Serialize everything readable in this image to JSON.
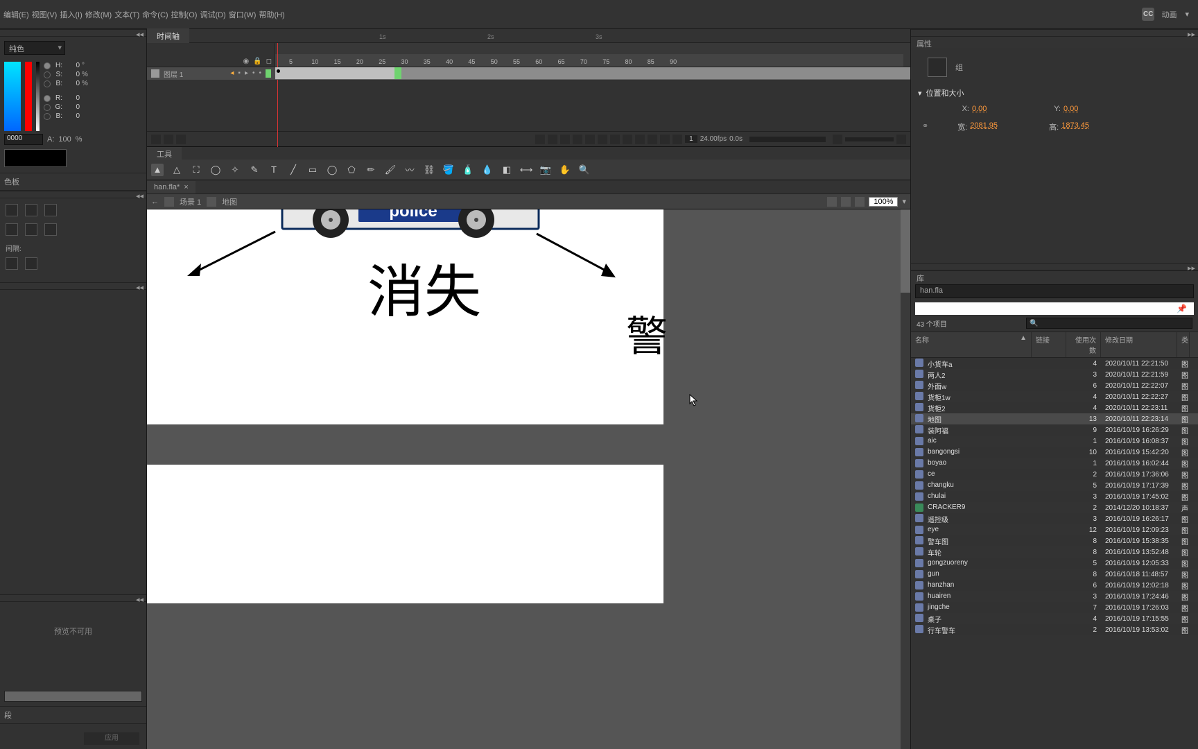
{
  "menu": {
    "items": [
      "编辑(E)",
      "视图(V)",
      "插入(I)",
      "修改(M)",
      "文本(T)",
      "命令(C)",
      "控制(O)",
      "调试(D)",
      "窗口(W)",
      "帮助(H)"
    ],
    "cc": "CC",
    "workspace": "动画",
    "wscarrot": "▾"
  },
  "left": {
    "color_mode": "纯色",
    "hsb": [
      {
        "l": "H:",
        "v": "0",
        "u": "°"
      },
      {
        "l": "S:",
        "v": "0",
        "u": "%"
      },
      {
        "l": "B:",
        "v": "0",
        "u": "%"
      }
    ],
    "rgb": [
      {
        "l": "R:",
        "v": "0"
      },
      {
        "l": "G:",
        "v": "0"
      },
      {
        "l": "B:",
        "v": "0"
      }
    ],
    "alpha_label": "A:",
    "alpha_val": "100",
    "alpha_unit": "%",
    "hex": "0000",
    "swatch_name": "色板",
    "align_label": "间隔:",
    "preview_text": "预览不可用",
    "historyname": "段",
    "apply": "应用"
  },
  "timeline": {
    "tab": "时间轴",
    "layer": "图层 1",
    "ruler_nums": [
      "5",
      "10",
      "15",
      "20",
      "25",
      "30",
      "35",
      "40",
      "45",
      "50",
      "55",
      "60",
      "65",
      "70",
      "75",
      "80",
      "85",
      "90"
    ],
    "sec_marks": [
      "1s",
      "2s",
      "3s"
    ],
    "frame_num": "1",
    "fps": "24.00fps",
    "time": "0.0s"
  },
  "tools": {
    "tab": "工具"
  },
  "doc": {
    "tab": "han.fla*",
    "close": "×"
  },
  "nav": {
    "back": "←",
    "sc_icon": "",
    "scene": "场景 1",
    "sym_icon": "",
    "symbol": "地图",
    "zoom": "100%"
  },
  "stage": {
    "big": "消失",
    "partial": "警",
    "police": "police"
  },
  "props": {
    "hdr": "属性",
    "group": "组",
    "section": "位置和大小",
    "x_l": "X:",
    "x_v": "0.00",
    "y_l": "Y:",
    "y_v": "0.00",
    "w_l": "宽:",
    "w_v": "2081.95",
    "h_l": "高:",
    "h_v": "1873.45"
  },
  "lib": {
    "hdr": "库",
    "file": "han.fla",
    "count": "43 个项目",
    "search_icon": "🔍",
    "cols": {
      "name": "名称",
      "link": "链接",
      "use": "使用次数",
      "date": "修改日期",
      "type": "类"
    },
    "sort": "▲",
    "selected_index": 5,
    "items": [
      {
        "n": "小货车a",
        "u": "4",
        "d": "2020/10/11 22:21:50",
        "t": "图"
      },
      {
        "n": "两人2",
        "u": "3",
        "d": "2020/10/11 22:21:59",
        "t": "图"
      },
      {
        "n": "外面w",
        "u": "6",
        "d": "2020/10/11 22:22:07",
        "t": "图"
      },
      {
        "n": "货柜1w",
        "u": "4",
        "d": "2020/10/11 22:22:27",
        "t": "图"
      },
      {
        "n": "货柜2",
        "u": "4",
        "d": "2020/10/11 22:23:11",
        "t": "图"
      },
      {
        "n": "地图",
        "u": "13",
        "d": "2020/10/11 22:23:14",
        "t": "图"
      },
      {
        "n": "装阿福",
        "u": "9",
        "d": "2016/10/19 16:26:29",
        "t": "图"
      },
      {
        "n": "aic",
        "u": "1",
        "d": "2016/10/19 16:08:37",
        "t": "图"
      },
      {
        "n": "bangongsi",
        "u": "10",
        "d": "2016/10/19 15:42:20",
        "t": "图"
      },
      {
        "n": "boyao",
        "u": "1",
        "d": "2016/10/19 16:02:44",
        "t": "图"
      },
      {
        "n": "ce",
        "u": "2",
        "d": "2016/10/19 17:36:06",
        "t": "图"
      },
      {
        "n": "changku",
        "u": "5",
        "d": "2016/10/19 17:17:39",
        "t": "图"
      },
      {
        "n": "chulai",
        "u": "3",
        "d": "2016/10/19 17:45:02",
        "t": "图"
      },
      {
        "n": "CRACKER9",
        "u": "2",
        "d": "2014/12/20 10:18:37",
        "t": "声",
        "snd": true
      },
      {
        "n": "遥控级",
        "u": "3",
        "d": "2016/10/19 16:26:17",
        "t": "图"
      },
      {
        "n": "eye",
        "u": "12",
        "d": "2016/10/19 12:09:23",
        "t": "图"
      },
      {
        "n": "警车图",
        "u": "8",
        "d": "2016/10/19 15:38:35",
        "t": "图"
      },
      {
        "n": "车轮",
        "u": "8",
        "d": "2016/10/19 13:52:48",
        "t": "图"
      },
      {
        "n": "gongzuoreny",
        "u": "5",
        "d": "2016/10/19 12:05:33",
        "t": "图"
      },
      {
        "n": "gun",
        "u": "8",
        "d": "2016/10/18 11:48:57",
        "t": "图"
      },
      {
        "n": "hanzhan",
        "u": "6",
        "d": "2016/10/19 12:02:18",
        "t": "图"
      },
      {
        "n": "huairen",
        "u": "3",
        "d": "2016/10/19 17:24:46",
        "t": "图"
      },
      {
        "n": "jingche",
        "u": "7",
        "d": "2016/10/19 17:26:03",
        "t": "图"
      },
      {
        "n": "桌子",
        "u": "4",
        "d": "2016/10/19 17:15:55",
        "t": "图"
      },
      {
        "n": "行车警车",
        "u": "2",
        "d": "2016/10/19 13:53:02",
        "t": "图"
      }
    ]
  },
  "chart_data": null
}
